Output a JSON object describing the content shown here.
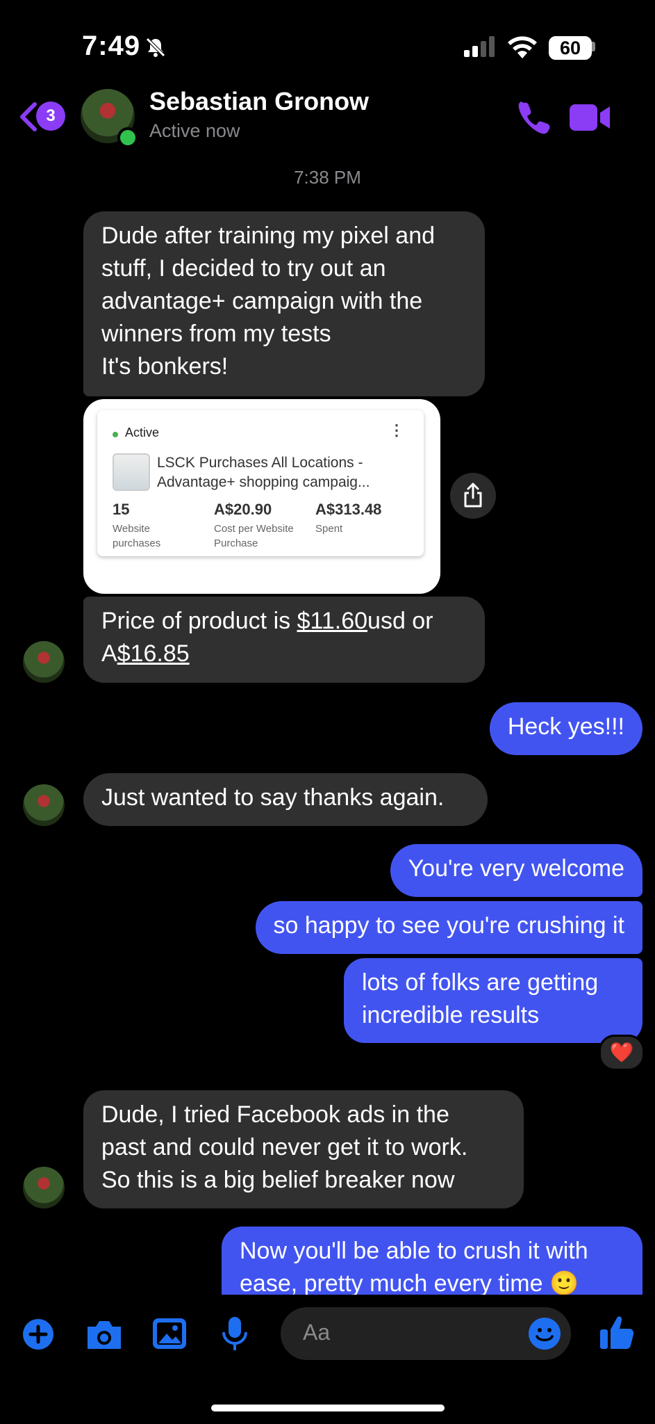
{
  "status_bar": {
    "time": "7:49",
    "battery": "60"
  },
  "header": {
    "back_badge": "3",
    "name": "Sebastian Gronow",
    "status": "Active now"
  },
  "timestamp": "7:38 PM",
  "messages": {
    "m1": "Dude after training my pixel and\nstuff, I decided to try out an\nadvantage+ campaign with the\nwinners from my tests\nIt's bonkers!",
    "m2_a": "Price of product is ",
    "m2_b": "$11.60",
    "m2_c": "usd or",
    "m2_d": "A",
    "m2_e": "$16.85",
    "m3": "Heck yes!!!",
    "m4": "Just wanted to say thanks again.",
    "m5": "You're very welcome",
    "m6": "so happy to see you're crushing it",
    "m7": "lots of folks are getting\nincredible results",
    "m8": "Dude, I tried Facebook ads in the\npast and could never get it to work.\nSo this is a big belief breaker now",
    "m9": "Now you'll be able to crush it with\nease, pretty much every time 🙂"
  },
  "ad_card": {
    "status": "Active",
    "title": "LSCK Purchases All Locations -\nAdvantage+ shopping campaig...",
    "stats": [
      {
        "value": "15",
        "label": "Website\npurchases"
      },
      {
        "value": "A$20.90",
        "label": "Cost per Website\nPurchase"
      },
      {
        "value": "A$313.48",
        "label": "Spent"
      }
    ]
  },
  "reaction": "❤️",
  "composer": {
    "placeholder": "Aa"
  },
  "colors": {
    "accent": "#8b3cf5",
    "outgoing": "#4254f0",
    "incoming": "#303030",
    "icon_blue": "#1e6ff0"
  }
}
